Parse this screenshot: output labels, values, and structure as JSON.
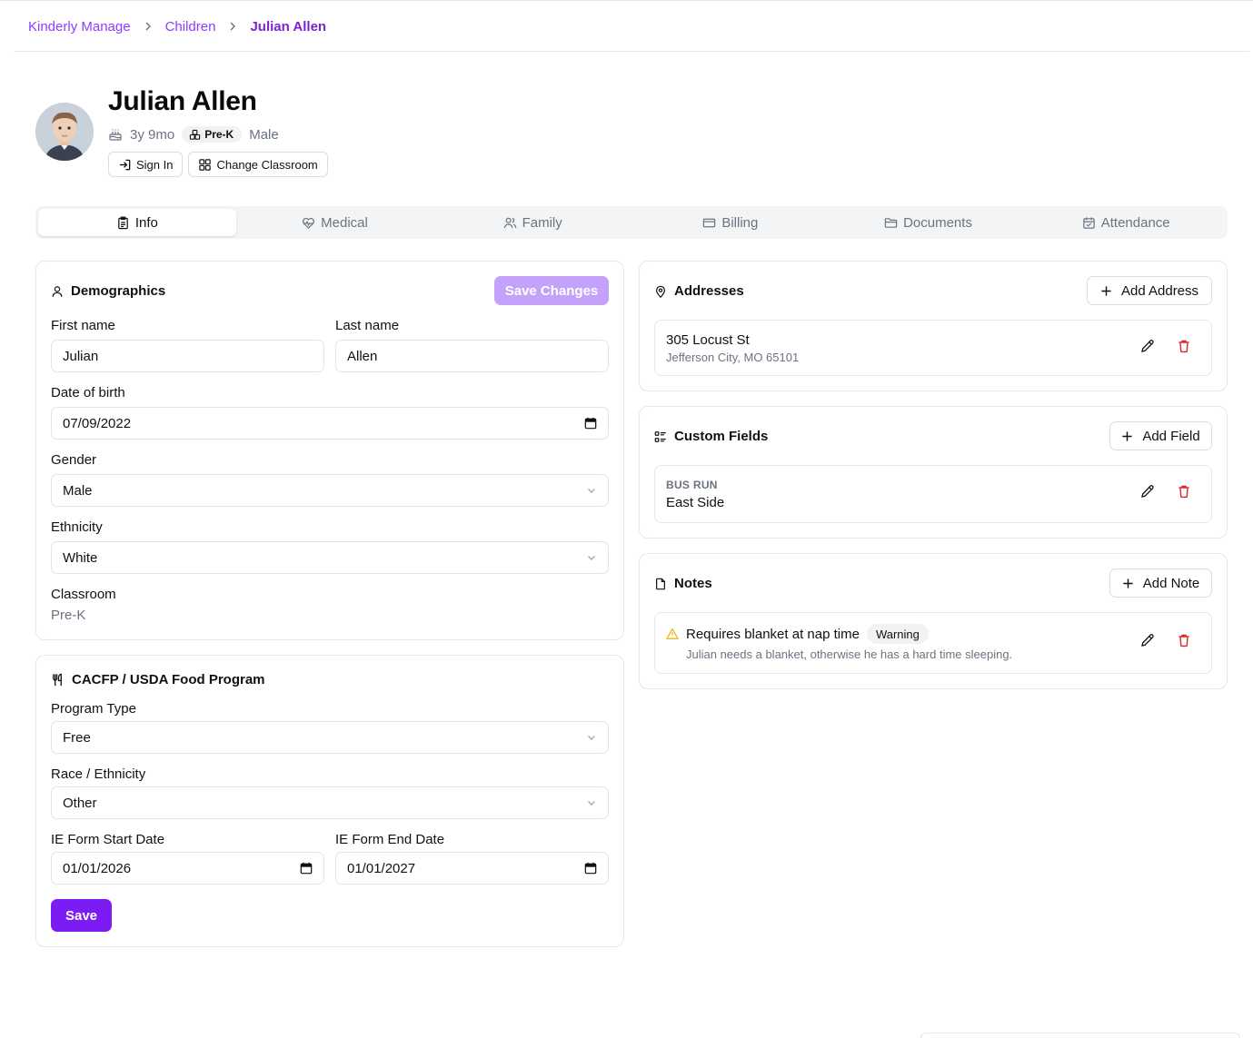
{
  "breadcrumb": {
    "root": "Kinderly Manage",
    "section": "Children",
    "current": "Julian Allen"
  },
  "child": {
    "name": "Julian Allen",
    "age": "3y 9mo",
    "classroom_badge": "Pre-K",
    "gender": "Male"
  },
  "actions": {
    "sign_in": "Sign In",
    "change_classroom": "Change Classroom"
  },
  "tabs": [
    {
      "label": "Info",
      "icon": "clipboard-icon",
      "active": true
    },
    {
      "label": "Medical",
      "icon": "heart-pulse-icon"
    },
    {
      "label": "Family",
      "icon": "users-icon"
    },
    {
      "label": "Billing",
      "icon": "credit-card-icon"
    },
    {
      "label": "Documents",
      "icon": "folder-icon"
    },
    {
      "label": "Attendance",
      "icon": "calendar-icon"
    }
  ],
  "demographics": {
    "title": "Demographics",
    "save_label": "Save Changes",
    "first_name_label": "First name",
    "first_name": "Julian",
    "last_name_label": "Last name",
    "last_name": "Allen",
    "dob_label": "Date of birth",
    "dob": "07/09/2022",
    "gender_label": "Gender",
    "gender": "Male",
    "ethnicity_label": "Ethnicity",
    "ethnicity": "White",
    "classroom_label": "Classroom",
    "classroom": "Pre-K"
  },
  "food_program": {
    "title": "CACFP / USDA Food Program",
    "program_type_label": "Program Type",
    "program_type": "Free",
    "race_label": "Race / Ethnicity",
    "race": "Other",
    "start_label": "IE Form Start Date",
    "start": "01/01/2026",
    "end_label": "IE Form End Date",
    "end": "01/01/2027",
    "save_label": "Save"
  },
  "addresses": {
    "title": "Addresses",
    "add_label": "Add Address",
    "items": [
      {
        "street": "305 Locust St",
        "city": "Jefferson City, MO 65101"
      }
    ]
  },
  "custom_fields": {
    "title": "Custom Fields",
    "add_label": "Add Field",
    "items": [
      {
        "name": "BUS RUN",
        "value": "East Side"
      }
    ]
  },
  "notes": {
    "title": "Notes",
    "add_label": "Add Note",
    "items": [
      {
        "title": "Requires blanket at nap time",
        "badge": "Warning",
        "body": "Julian needs a blanket, otherwise he has a hard time sleeping."
      }
    ]
  },
  "colors": {
    "accent": "#7c1cf5",
    "accent_light": "#c4a1fb",
    "link": "#8b3dff",
    "danger": "#dc2626",
    "warning": "#eab308"
  }
}
